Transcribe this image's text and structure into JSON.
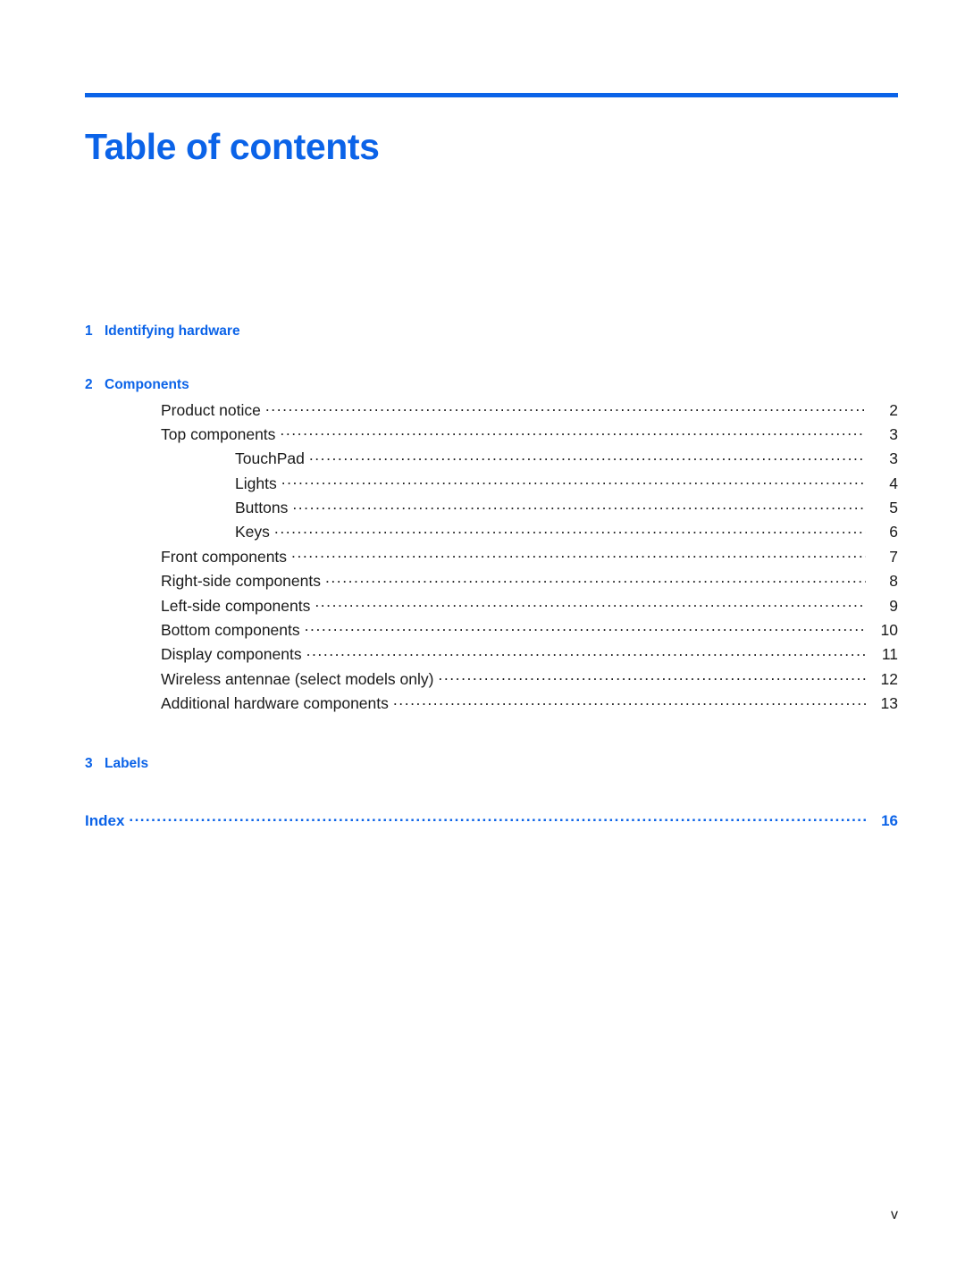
{
  "document": {
    "title": "Table of contents",
    "accent_color": "#0b63e8",
    "body_text_color": "#1a1a1a",
    "footer_page_label": "v"
  },
  "toc": {
    "chapters": [
      {
        "number": "1",
        "title": "Identifying hardware",
        "entries": []
      },
      {
        "number": "2",
        "title": "Components",
        "entries": [
          {
            "label": "Product notice",
            "page": "2",
            "level": 1
          },
          {
            "label": "Top components",
            "page": "3",
            "level": 1
          },
          {
            "label": "TouchPad",
            "page": "3",
            "level": 2
          },
          {
            "label": "Lights",
            "page": "4",
            "level": 2
          },
          {
            "label": "Buttons",
            "page": "5",
            "level": 2
          },
          {
            "label": "Keys",
            "page": "6",
            "level": 2
          },
          {
            "label": "Front components",
            "page": "7",
            "level": 1
          },
          {
            "label": "Right-side components",
            "page": "8",
            "level": 1
          },
          {
            "label": "Left-side components",
            "page": "9",
            "level": 1
          },
          {
            "label": "Bottom components",
            "page": "10",
            "level": 1
          },
          {
            "label": "Display components",
            "page": "11",
            "level": 1
          },
          {
            "label": "Wireless antennae (select models only)",
            "page": "12",
            "level": 1
          },
          {
            "label": "Additional hardware components",
            "page": "13",
            "level": 1
          }
        ]
      },
      {
        "number": "3",
        "title": "Labels",
        "entries": []
      }
    ],
    "index_entry": {
      "label": "Index",
      "page": "16"
    }
  }
}
